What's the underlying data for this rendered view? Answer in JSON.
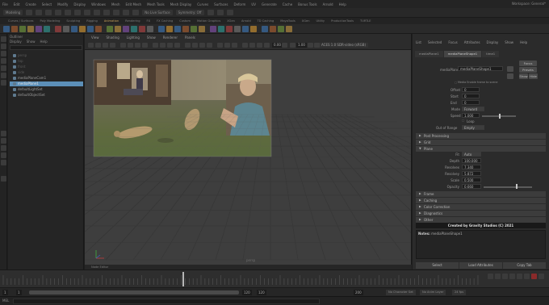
{
  "menubar": {
    "items": [
      "File",
      "Edit",
      "Create",
      "Select",
      "Modify",
      "Display",
      "Windows",
      "Mesh",
      "Edit Mesh",
      "Mesh Tools",
      "Mesh Display",
      "Curves",
      "Surfaces",
      "Deform",
      "UV",
      "Generate",
      "Cache",
      "Bonus Tools",
      "Arnold",
      "Help"
    ],
    "workspace_label": "Workspace: General*"
  },
  "statusline": {
    "mode_menu": "Modeling",
    "live_surface": "No Live Surface",
    "symmetry": "Symmetry: Off"
  },
  "shelf": {
    "tabs": [
      "Curves / Surfaces",
      "Poly Modeling",
      "Sculpting",
      "Rigging",
      "Animation",
      "Rendering",
      "FX",
      "FX Caching",
      "Custom",
      "Motion Graphics",
      "XGen",
      "Arnold",
      "TD Caching",
      "MayaTools",
      "XGen",
      "Utility",
      "ProductionTools",
      "TURTLE"
    ],
    "active_tab": "Animation",
    "icon_colors": [
      "#3a6ea5",
      "#9e5a2f",
      "#6a8f3a",
      "#b0893e",
      "#7a4d9e",
      "#2f8f8a",
      "#a54040",
      "#6d6d6d",
      "#3a6ea5",
      "#c08a30"
    ]
  },
  "outliner": {
    "title": "Outliner",
    "menus": [
      "Display",
      "Show",
      "Help"
    ],
    "rows": [
      {
        "label": "persp",
        "state": "dim"
      },
      {
        "label": "top",
        "state": "dim"
      },
      {
        "label": "front",
        "state": "dim"
      },
      {
        "label": "side",
        "state": "dim"
      },
      {
        "label": "mediaPlaneCam1",
        "state": "normal"
      },
      {
        "label": "mediaPlane1",
        "state": "selected"
      },
      {
        "label": "defaultLightSet",
        "state": "normal"
      },
      {
        "label": "defaultObjectSet",
        "state": "normal"
      }
    ]
  },
  "viewport": {
    "menus": [
      "View",
      "Shading",
      "Lighting",
      "Show",
      "Renderer",
      "Panels"
    ],
    "near_value": "0.00",
    "far_value": "1.00",
    "color_space": "ACES 1.0 SDR-video (sRGB)",
    "camera_label": "persp"
  },
  "attribute_editor": {
    "menus": [
      "List",
      "Selected",
      "Focus",
      "Attributes",
      "Display",
      "Show",
      "Help"
    ],
    "tabs": [
      "mediaPlane1",
      "mediaPlaneShape1",
      "time1"
    ],
    "active_tab": "mediaPlaneShape1",
    "node_label": "mediaPlane:",
    "node_value": "mediaPlaneShape1",
    "focus_button": "Focus",
    "presets_button": "Presets",
    "show_button": "Show",
    "hide_button": "Hide",
    "checkbox_label": "Media Enable frame to scene",
    "fields": [
      {
        "label": "Offset",
        "value": "0"
      },
      {
        "label": "Start",
        "value": "0"
      },
      {
        "label": "End",
        "value": "0"
      }
    ],
    "mode_label": "Mode",
    "mode_value": "Forward",
    "speed_label": "Speed",
    "speed_value": "1.000",
    "speed_fraction": 0.5,
    "loop_label": "Loop",
    "out_of_range_label": "Out of Range",
    "out_of_range_value": "Empty",
    "sections_top": [
      "Post Processing",
      "Grid",
      "Plane"
    ],
    "plane_fields": [
      {
        "label": "Fit",
        "value": "Auto",
        "type": "drop"
      },
      {
        "label": "Depth",
        "value": "100.000"
      },
      {
        "label": "Resolvex",
        "value": "7.340"
      },
      {
        "label": "Resolvey",
        "value": "5.872"
      },
      {
        "label": "Scale",
        "value": "0.500"
      },
      {
        "label": "Opacity",
        "value": "0.660",
        "slider": 0.66
      }
    ],
    "sections_bottom": [
      "Frame",
      "Caching",
      "Color Correction",
      "Diagnostics",
      "Other"
    ],
    "credit": "Created by Gravity Studios (C) 2021",
    "notes_label": "Notes:",
    "notes_value": "mediaPlaneShape1",
    "bottom_buttons": [
      "Select",
      "Load Attributes",
      "Copy Tab"
    ]
  },
  "vpbottom": {
    "label": "Node Editor"
  },
  "range": {
    "start": "1",
    "start_inner": "1",
    "end_inner": "120",
    "end": "120",
    "end_alt": "200",
    "character_set": "No Character Set",
    "anim_layer": "No Anim Layer",
    "fps": "24 fps"
  },
  "cmdline": {
    "mel_label": "MEL"
  }
}
